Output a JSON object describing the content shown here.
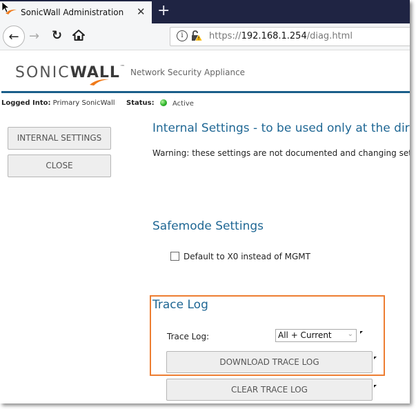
{
  "browser": {
    "tab_title": "SonicWall Administration",
    "tab_close_glyph": "✕",
    "new_tab_glyph": "+",
    "nav": {
      "back_glyph": "←",
      "forward_glyph": "→",
      "reload_glyph": "↻"
    },
    "url": {
      "scheme": "https://",
      "host": "192.168.1.254",
      "path": "/diag.html",
      "info_glyph": "i"
    }
  },
  "header": {
    "brand_sonic": "SONIC",
    "brand_wall": "WALL",
    "brand_tm": "™",
    "tagline": "Network Security Appliance",
    "logged_into_label": "Logged Into:",
    "logged_into_value": "Primary SonicWall",
    "status_label": "Status:",
    "status_value": "Active",
    "status_color": "#2db52a",
    "accent_color": "#1a5e8a"
  },
  "sidebar": {
    "buttons": [
      {
        "label": "INTERNAL SETTINGS"
      },
      {
        "label": "CLOSE"
      }
    ]
  },
  "main": {
    "title": "Internal Settings - to be used only at the directi",
    "warning": "Warning: these settings are not documented and changing setting",
    "safemode": {
      "title": "Safemode Settings",
      "checkbox_label": "Default to X0 instead of MGMT",
      "checked": false
    },
    "trace_log": {
      "title": "Trace Log",
      "field_label": "Trace Log:",
      "selected_option": "All + Current",
      "select_chevron": "⌄",
      "download_button": "DOWNLOAD TRACE LOG",
      "clear_button": "CLEAR TRACE LOG",
      "highlight_color": "#ed7d31"
    }
  }
}
